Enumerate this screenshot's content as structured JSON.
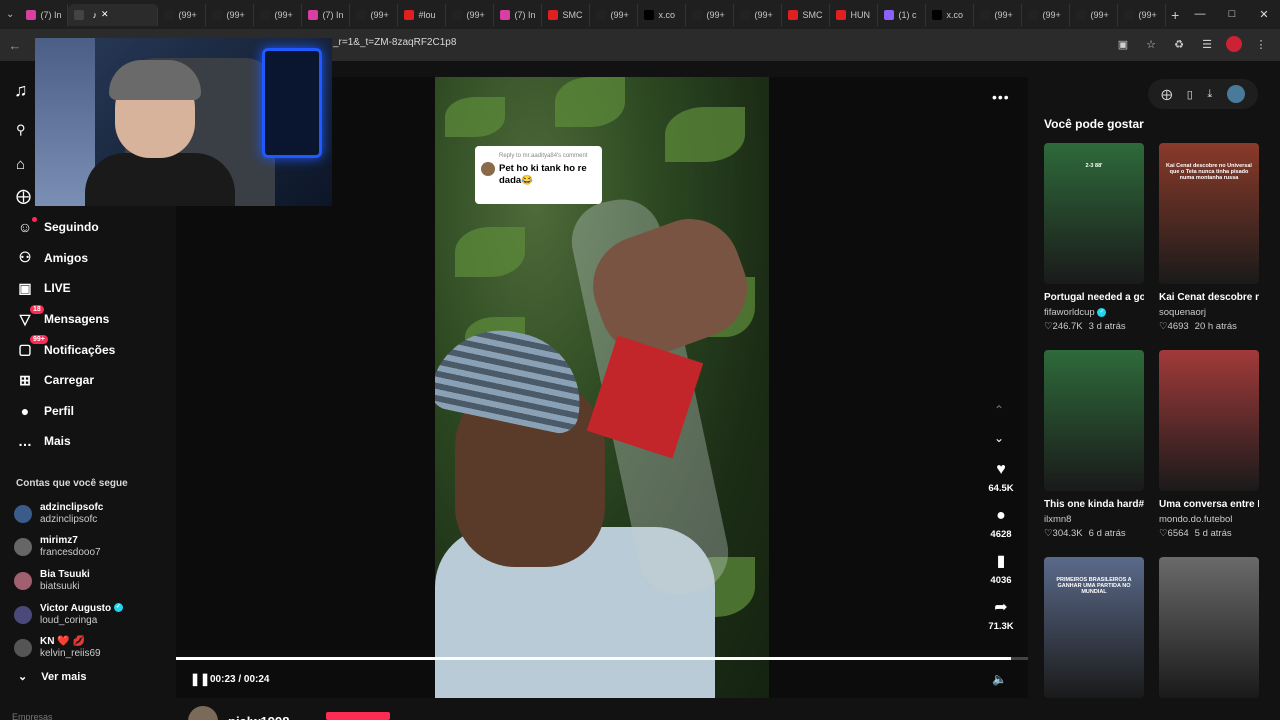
{
  "browser": {
    "tabs": [
      {
        "label": "(7) In",
        "fav": "#d83fa0"
      },
      {
        "label": "",
        "fav": "#444",
        "active": true
      },
      {
        "label": "(99+",
        "fav": "#222"
      },
      {
        "label": "(99+",
        "fav": "#222"
      },
      {
        "label": "(99+",
        "fav": "#222"
      },
      {
        "label": "(7) In",
        "fav": "#d83fa0"
      },
      {
        "label": "(99+",
        "fav": "#222"
      },
      {
        "label": "#lou",
        "fav": "#e02020"
      },
      {
        "label": "(99+",
        "fav": "#222"
      },
      {
        "label": "(7) In",
        "fav": "#d83fa0"
      },
      {
        "label": "SMC",
        "fav": "#e02020"
      },
      {
        "label": "(99+",
        "fav": "#222"
      },
      {
        "label": "x.co",
        "fav": "#000"
      },
      {
        "label": "(99+",
        "fav": "#222"
      },
      {
        "label": "(99+",
        "fav": "#222"
      },
      {
        "label": "SMC",
        "fav": "#e02020"
      },
      {
        "label": "HUN",
        "fav": "#e02020"
      },
      {
        "label": "(1) c",
        "fav": "#8a60ff"
      },
      {
        "label": "x.co",
        "fav": "#000"
      },
      {
        "label": "(99+",
        "fav": "#222"
      },
      {
        "label": "(99+",
        "fav": "#222"
      },
      {
        "label": "(99+",
        "fav": "#222"
      },
      {
        "label": "(99+",
        "fav": "#222"
      }
    ],
    "url": "_r=1&_t=ZM-8zaqRF2C1p8"
  },
  "sidebar": {
    "items": [
      {
        "label": "Seguindo",
        "icon": "user-follow-icon",
        "glyph": "☺"
      },
      {
        "label": "Amigos",
        "icon": "friends-icon",
        "glyph": "⚇"
      },
      {
        "label": "LIVE",
        "icon": "live-icon",
        "glyph": "▣"
      },
      {
        "label": "Mensagens",
        "icon": "messages-icon",
        "glyph": "▽",
        "badge": "18"
      },
      {
        "label": "Notificações",
        "icon": "notifications-icon",
        "glyph": "▢",
        "badge": "99+"
      },
      {
        "label": "Carregar",
        "icon": "upload-icon",
        "glyph": "⊞"
      },
      {
        "label": "Perfil",
        "icon": "profile-icon",
        "glyph": "●"
      },
      {
        "label": "Mais",
        "icon": "more-icon",
        "glyph": "…"
      }
    ],
    "following_title": "Contas que você segue",
    "following": [
      {
        "name": "adzinclipsofc",
        "user": "adzinclipsofc",
        "color": "#3b5b8a"
      },
      {
        "name": "mirimz7",
        "user": "francesdooo7",
        "color": "#666"
      },
      {
        "name": "Bia Tsuuki",
        "user": "biatsuuki",
        "color": "#a06070"
      },
      {
        "name": "Victor Augusto",
        "user": "loud_coringa",
        "color": "#4a4a7a",
        "verified": true
      },
      {
        "name": "KN ❤️ 💋",
        "user": "kelvin_reiis69",
        "color": "#555"
      }
    ],
    "see_more": "Ver mais",
    "bottom_hint": "Empresas"
  },
  "video": {
    "reply_head": "Reply to mr.aaditya84's comment",
    "reply_text": "Pet ho ki tank ho re dada😂",
    "counts": {
      "likes": "64.5K",
      "comments": "4628",
      "saves": "4036",
      "shares": "71.3K"
    },
    "time": "00:23 / 00:24",
    "progress": 0.98,
    "author": "pialw1998"
  },
  "right": {
    "title": "Você pode gostar",
    "cards": [
      {
        "caption": "Portugal needed a goal. Cristiano...",
        "user": "fifaworldcup",
        "verified": true,
        "likes": "246.7K",
        "age": "3 d atrás",
        "thumb": "#2e6a3a",
        "thumb_text": "2-3  88'"
      },
      {
        "caption": "Kai Cenat descobre no Universal que o...",
        "user": "soquenaorj",
        "likes": "4693",
        "age": "20 h atrás",
        "thumb": "#8a3a2a",
        "thumb_text": "Kai Cenat descobre no Universal que o Teta nunca tinha pisado numa montanha russa"
      },
      {
        "caption": "This one kinda hard#lamineyamal...",
        "user": "ilxmn8",
        "likes": "304.3K",
        "age": "6 d atrás",
        "thumb": "#2e6a3a",
        "thumb_text": ""
      },
      {
        "caption": "Uma conversa entre Lamine Yamal e...",
        "user": "mondo.do.futebol",
        "likes": "6564",
        "age": "5 d atrás",
        "thumb": "#a23a3a",
        "thumb_text": ""
      },
      {
        "caption": "",
        "user": "",
        "likes": "",
        "age": "",
        "thumb": "#5a6a8a",
        "thumb_text": "PRIMEIROS BRASILEIROS A GANHAR UMA PARTIDA NO MUNDIAL"
      },
      {
        "caption": "",
        "user": "",
        "likes": "",
        "age": "",
        "thumb": "#6a6a6a",
        "thumb_text": ""
      }
    ]
  }
}
